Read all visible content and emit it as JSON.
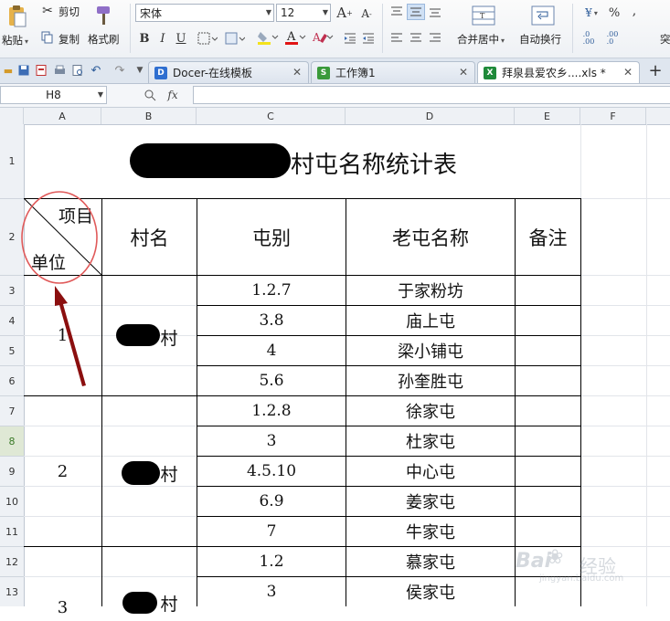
{
  "ribbon": {
    "paste": "粘贴",
    "cut": "剪切",
    "copy": "复制",
    "format_painter": "格式刷",
    "font_name": "宋体",
    "font_size": "12",
    "bold": "B",
    "italic": "I",
    "underline": "U",
    "grow_font": "A",
    "shrink_font": "A",
    "merge_center": "合并居中",
    "wrap_text": "自动换行",
    "percent": "%",
    "comma": ",",
    "cut_off": "突"
  },
  "tabs": [
    {
      "label": "Docer-在线模板",
      "icon": "docer-icon"
    },
    {
      "label": "工作簿1",
      "icon": "sheet-icon"
    },
    {
      "label": "拜泉县爱农乡....xls *",
      "icon": "excel-icon"
    }
  ],
  "formula_bar": {
    "cell_ref": "H8",
    "fx": "fx",
    "value": ""
  },
  "columns": [
    "A",
    "B",
    "C",
    "D",
    "E",
    "F"
  ],
  "rows": [
    "1",
    "2",
    "3",
    "4",
    "5",
    "6",
    "7",
    "8",
    "9",
    "10",
    "11",
    "12",
    "13"
  ],
  "selected_row": "8",
  "sheet": {
    "title": "村屯名称统计表",
    "header": {
      "diag_top": "项目",
      "diag_bottom": "单位",
      "village": "村名",
      "group": "屯别",
      "old_name": "老屯名称",
      "remark": "备注"
    },
    "units": [
      "1",
      "2",
      "3"
    ],
    "village_suffix": "村",
    "entries": [
      {
        "group": "1.2.7",
        "old_name": "于家粉坊"
      },
      {
        "group": "3.8",
        "old_name": "庙上屯"
      },
      {
        "group": "4",
        "old_name": "梁小铺屯"
      },
      {
        "group": "5.6",
        "old_name": "孙奎胜屯"
      },
      {
        "group": "1.2.8",
        "old_name": "徐家屯"
      },
      {
        "group": "3",
        "old_name": "杜家屯"
      },
      {
        "group": "4.5.10",
        "old_name": "中心屯"
      },
      {
        "group": "6.9",
        "old_name": "姜家屯"
      },
      {
        "group": "7",
        "old_name": "牛家屯"
      },
      {
        "group": "1.2",
        "old_name": "慕家屯"
      },
      {
        "group": "3",
        "old_name": "侯家屯"
      }
    ]
  },
  "watermark": {
    "brand": "Bai",
    "brand_cn": "经验",
    "url": "jingyan.baidu.com"
  },
  "colors": {
    "annotation": "#8b0f0f",
    "circle": "#e05a5a",
    "selected_row": "#3a7a28"
  }
}
